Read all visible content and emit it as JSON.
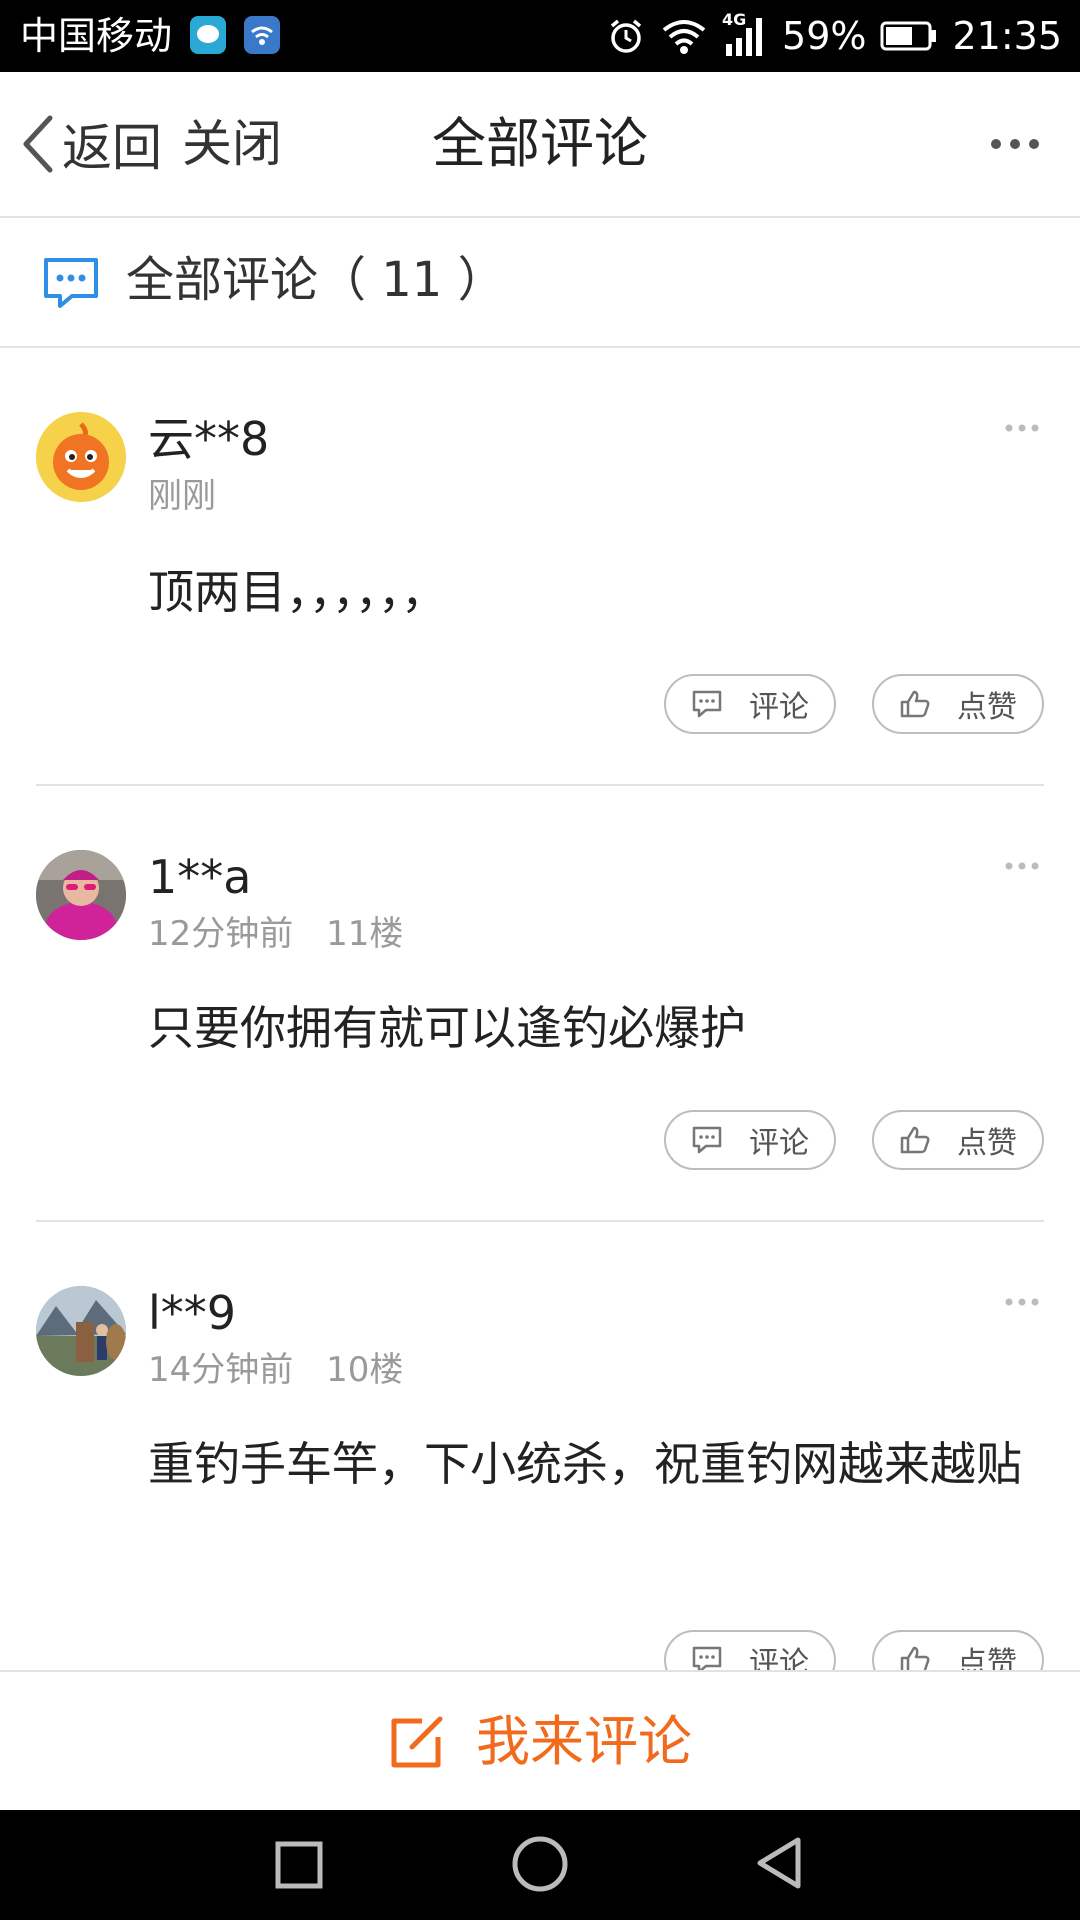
{
  "status_bar": {
    "carrier": "中国移动",
    "network": "4G",
    "battery": "59%",
    "time": "21:35"
  },
  "header": {
    "back_label": "返回",
    "close_label": "关闭",
    "title": "全部评论"
  },
  "section": {
    "label": "全部评论（ 11 ）"
  },
  "comments": [
    {
      "user": "云**8",
      "time": "刚刚",
      "floor": "",
      "text": "顶两目，，，，，，",
      "reply_label": "评论",
      "like_label": "点赞"
    },
    {
      "user": "1**a",
      "time": "12分钟前",
      "floor": "11楼",
      "text": "只要你拥有就可以逢钓必爆护",
      "reply_label": "评论",
      "like_label": "点赞"
    },
    {
      "user": "l**9",
      "time": "14分钟前",
      "floor": "10楼",
      "text": "重钓手车竿，下小统杀，祝重钓网越来越贴",
      "reply_label": "评论",
      "like_label": "点赞"
    }
  ],
  "bottom": {
    "compose_label": "我来评论"
  },
  "colors": {
    "accent": "#f26a1b",
    "icon_blue": "#2f8fe6"
  }
}
